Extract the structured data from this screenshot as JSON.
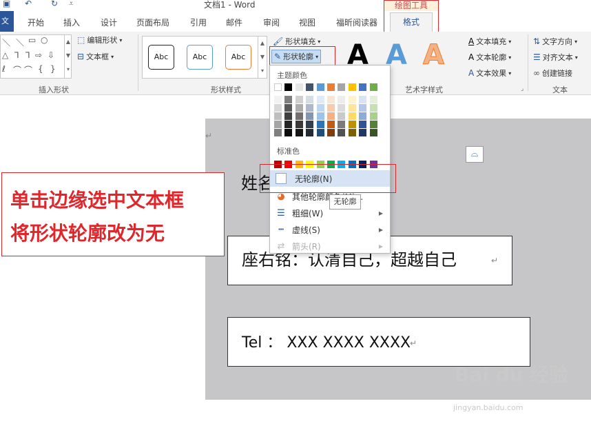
{
  "window": {
    "title": "文档1 - Word",
    "contextual_tab": "绘图工具"
  },
  "tabs": [
    "文件",
    "开始",
    "插入",
    "设计",
    "页面布局",
    "引用",
    "邮件",
    "审阅",
    "视图",
    "福昕阅读器",
    "格式"
  ],
  "ribbon": {
    "insert_shapes": {
      "label": "插入形状",
      "edit_shape": "编辑形状",
      "text_box": "文本框"
    },
    "shape_styles": {
      "label": "形状样式",
      "style_text": "Abc",
      "fill": "形状填充",
      "outline": "形状轮廓"
    },
    "wordart": {
      "label": "艺术字样式",
      "letter": "A",
      "text_fill": "文本填充",
      "text_outline": "文本轮廓",
      "text_effect": "文本效果"
    },
    "text": {
      "label": "文本",
      "direction": "文字方向",
      "align": "对齐文本",
      "link": "创建链接"
    }
  },
  "menu": {
    "theme_colors": "主题颜色",
    "standard_colors": "标准色",
    "theme_top": [
      "#ffffff",
      "#000000",
      "#e7e6e6",
      "#44546a",
      "#5b9bd5",
      "#ed7d31",
      "#a5a5a5",
      "#ffc000",
      "#4472c4",
      "#70ad47"
    ],
    "theme_shades": [
      [
        "#f2f2f2",
        "#7f7f7f",
        "#d0cece",
        "#d6dce4",
        "#deebf6",
        "#fbe5d5",
        "#ededed",
        "#fff2cc",
        "#dae3f3",
        "#e2efd9"
      ],
      [
        "#d8d8d8",
        "#595959",
        "#aeabab",
        "#adb9ca",
        "#bdd7ee",
        "#f7cbac",
        "#dbdbdb",
        "#fee599",
        "#b4c6e7",
        "#c5e0b3"
      ],
      [
        "#bfbfbf",
        "#3f3f3f",
        "#757070",
        "#8496b0",
        "#9dc3e6",
        "#f4b183",
        "#c9c9c9",
        "#ffd965",
        "#8eaadb",
        "#a8d08d"
      ],
      [
        "#a5a5a5",
        "#262626",
        "#3a3838",
        "#323f4f",
        "#2e75b5",
        "#c55a11",
        "#7b7b7b",
        "#bf9000",
        "#2f5496",
        "#538135"
      ],
      [
        "#7f7f7f",
        "#0c0c0c",
        "#171616",
        "#222a35",
        "#1e4e79",
        "#843c0b",
        "#525252",
        "#7f6000",
        "#1f3864",
        "#375623"
      ]
    ],
    "standard": [
      "#c00000",
      "#ff0000",
      "#ffc000",
      "#ffff00",
      "#92d050",
      "#00b050",
      "#00b0f0",
      "#0070c0",
      "#002060",
      "#7030a0"
    ],
    "items": {
      "no_outline": "无轮廓(N)",
      "more_colors": "其他轮廓颜色(M)...",
      "weight": "粗细(W)",
      "dashes": "虚线(S)",
      "arrows": "箭头(R)"
    },
    "tooltip": "无轮廓"
  },
  "document": {
    "name_partial": "姓名",
    "motto": "座右铭：认清自己，超越自己",
    "tel": "Tel  ：  XXX XXXX XXXX"
  },
  "annotation": {
    "line1": "单击边缘选中文本框",
    "line2": "将形状轮廓改为无"
  },
  "watermark": {
    "brand": "Bai du 经验",
    "url": "jingyan.baidu.com"
  }
}
